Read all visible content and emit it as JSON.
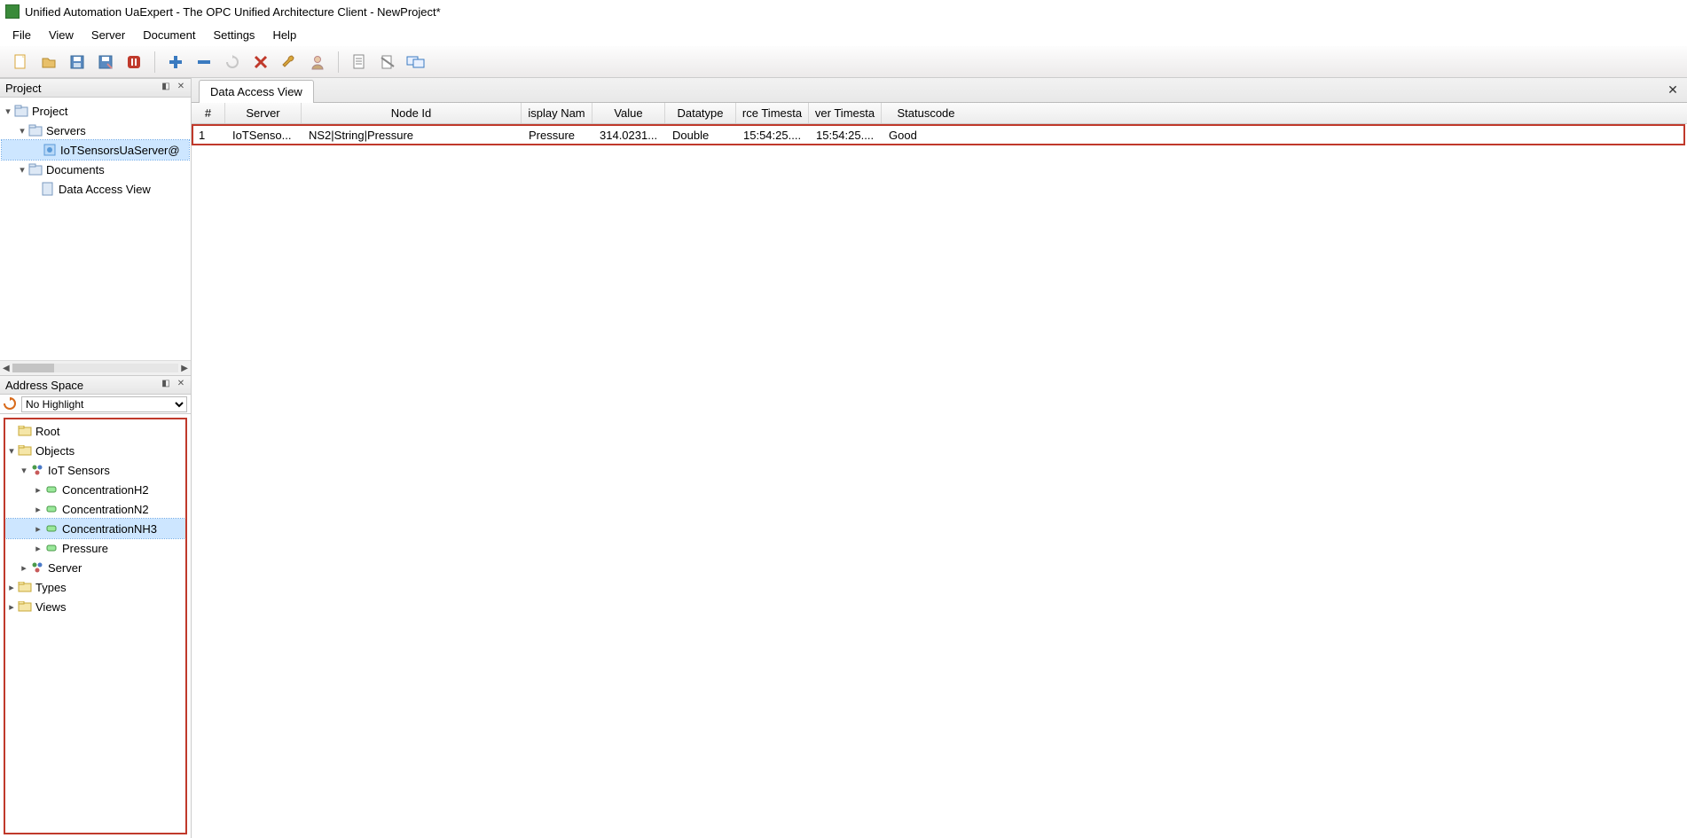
{
  "app": {
    "title": "Unified Automation UaExpert - The OPC Unified Architecture Client - NewProject*"
  },
  "menu": {
    "items": [
      "File",
      "View",
      "Server",
      "Document",
      "Settings",
      "Help"
    ]
  },
  "panels": {
    "project_title": "Project",
    "address_title": "Address Space"
  },
  "project_tree": {
    "root": "Project",
    "servers": "Servers",
    "server_item": "IoTSensorsUaServer@",
    "documents": "Documents",
    "doc_item": "Data Access View"
  },
  "address": {
    "highlight_label": "No Highlight",
    "root": "Root",
    "objects": "Objects",
    "iot_sensors": "IoT Sensors",
    "conc_h2": "ConcentrationH2",
    "conc_n2": "ConcentrationN2",
    "conc_nh3": "ConcentrationNH3",
    "pressure": "Pressure",
    "server": "Server",
    "types": "Types",
    "views": "Views"
  },
  "tabs": {
    "data_access": "Data Access View"
  },
  "table": {
    "headers": {
      "num": "#",
      "server": "Server",
      "node_id": "Node Id",
      "display_name": "isplay Nam",
      "value": "Value",
      "datatype": "Datatype",
      "src_ts": "rce Timesta",
      "srv_ts": "ver Timesta",
      "status": "Statuscode"
    },
    "row": {
      "num": "1",
      "server": "IoTSenso...",
      "node_id": "NS2|String|Pressure",
      "display_name": "Pressure",
      "value": "314.0231...",
      "datatype": "Double",
      "src_ts": "15:54:25....",
      "srv_ts": "15:54:25....",
      "status": "Good"
    }
  }
}
